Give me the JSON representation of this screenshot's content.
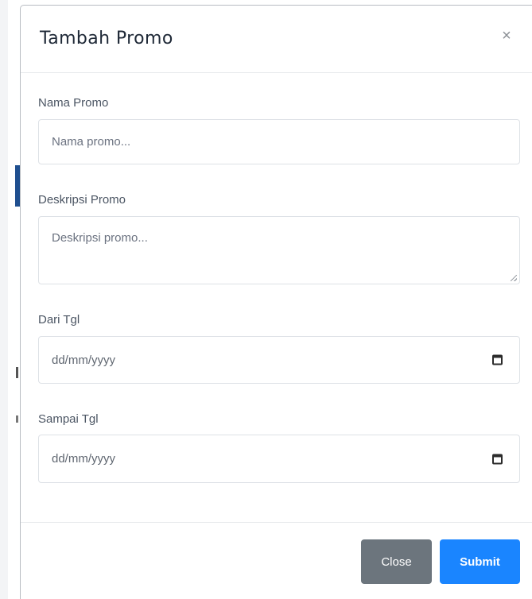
{
  "modal": {
    "title": "Tambah Promo",
    "close_glyph": "×"
  },
  "form": {
    "nama_promo": {
      "label": "Nama Promo",
      "placeholder": "Nama promo...",
      "value": ""
    },
    "deskripsi_promo": {
      "label": "Deskripsi Promo",
      "placeholder": "Deskripsi promo...",
      "value": ""
    },
    "dari_tgl": {
      "label": "Dari Tgl",
      "value": "dd/mm/yyyy",
      "icon": "calendar-icon"
    },
    "sampai_tgl": {
      "label": "Sampai Tgl",
      "value": "dd/mm/yyyy",
      "icon": "calendar-icon"
    }
  },
  "footer": {
    "close_label": "Close",
    "submit_label": "Submit"
  },
  "colors": {
    "close_button": "#6c757d",
    "submit_button": "#1a85ff",
    "background_accent": "#1f4f8f"
  }
}
